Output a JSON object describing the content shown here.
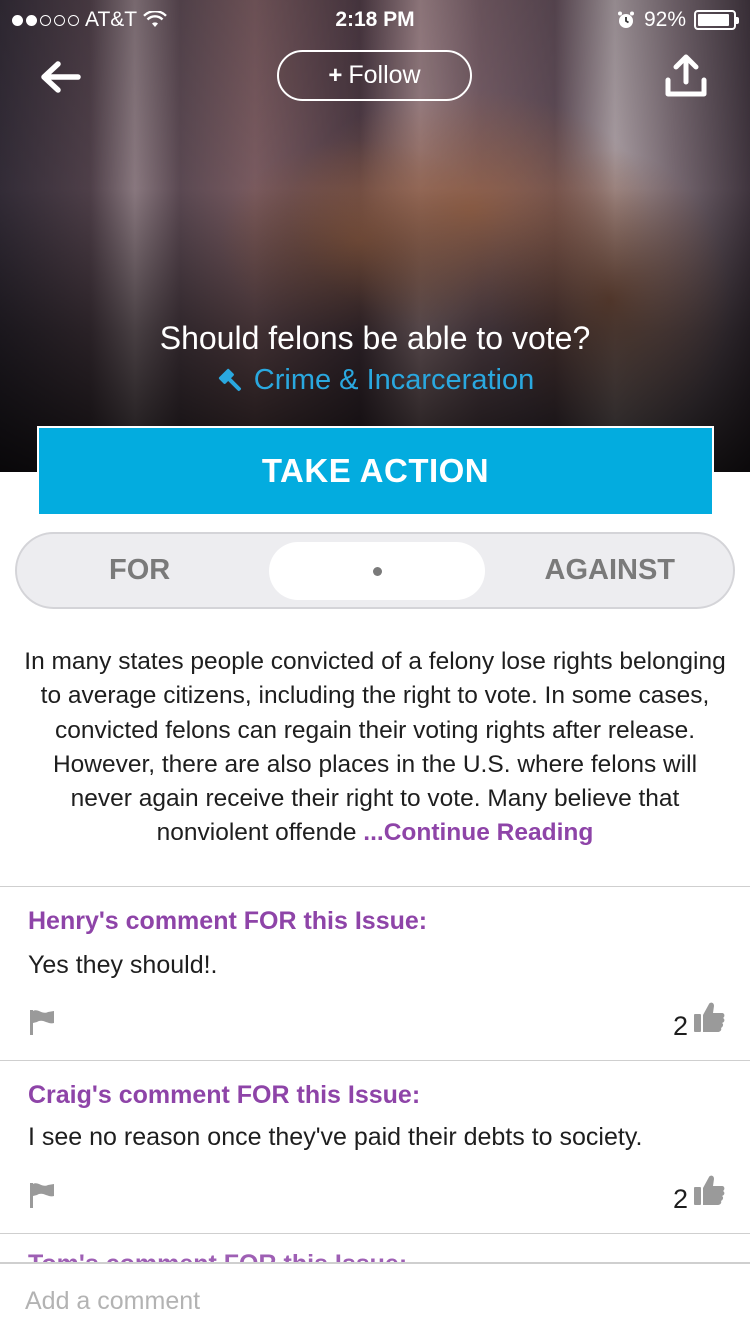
{
  "status_bar": {
    "carrier": "AT&T",
    "time": "2:18 PM",
    "battery": "92%",
    "battery_level": 0.92,
    "signal_bars_filled": 2,
    "signal_bars_total": 5
  },
  "header": {
    "follow_label": "Follow",
    "follow_plus": "+"
  },
  "issue": {
    "title": "Should felons be able to vote?",
    "category": "Crime & Incarceration"
  },
  "take_action_label": "TAKE ACTION",
  "stance_toggle": {
    "for_label": "FOR",
    "against_label": "AGAINST",
    "selected": "neutral"
  },
  "description": {
    "text": "In many states people convicted of a felony lose rights belonging to average citizens, including the right to vote. In some cases, convicted felons can regain their voting rights after release. However, there are also places in the U.S. where felons will never again receive their right to vote. Many believe that nonviolent offende ",
    "continue_label": "...Continue Reading"
  },
  "comments": [
    {
      "author": "Henry's comment FOR this Issue:",
      "text": "Yes they should!.",
      "likes": "2"
    },
    {
      "author": "Craig's comment FOR this Issue:",
      "text": "I see no reason once they've paid their debts to society.",
      "likes": "2"
    }
  ],
  "partial_comment_author": "Tom's comment FOR this Issue:",
  "comment_input": {
    "placeholder": "Add a comment"
  },
  "colors": {
    "accent_blue": "#03acdf",
    "category_blue": "#2aa8df",
    "purple": "#8e44a8",
    "toggle_bg": "#ededf0"
  }
}
